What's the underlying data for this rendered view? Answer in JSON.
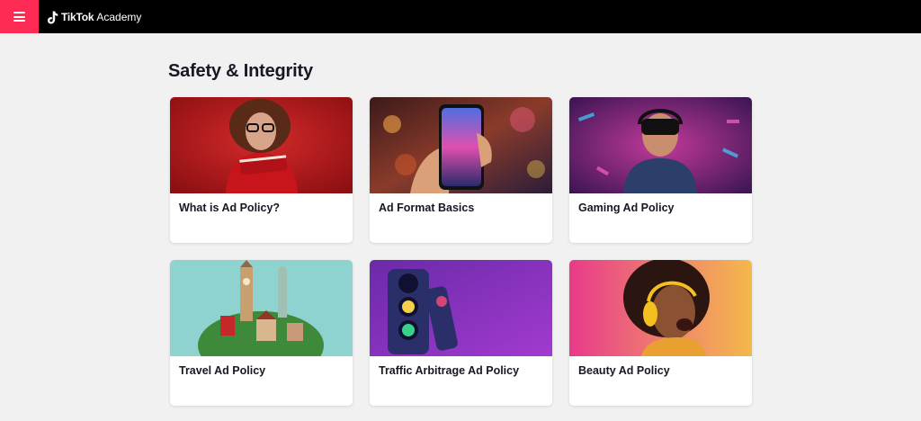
{
  "header": {
    "brand_strong": "TikTok",
    "brand_light": "Academy",
    "menu_icon": "hamburger-menu-icon",
    "accent_color": "#fe2c55"
  },
  "page": {
    "title": "Safety & Integrity"
  },
  "cards": [
    {
      "title": "What is Ad Policy?",
      "image": "woman-red-sweater-reading-book"
    },
    {
      "title": "Ad Format Basics",
      "image": "hand-holding-phone-street"
    },
    {
      "title": "Gaming Ad Policy",
      "image": "gamer-vr-headset-neon"
    },
    {
      "title": "Travel Ad Policy",
      "image": "landmarks-globe-collage"
    },
    {
      "title": "Traffic Arbitrage Ad Policy",
      "image": "traffic-light-bitcoin"
    },
    {
      "title": "Beauty Ad Policy",
      "image": "woman-headphones-laughing"
    }
  ]
}
